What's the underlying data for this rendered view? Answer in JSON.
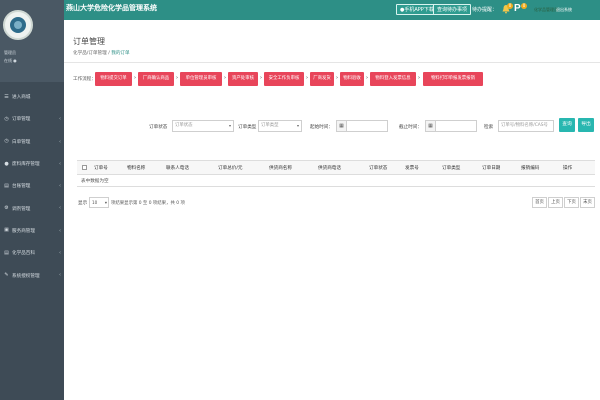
{
  "header": {
    "title": "燕山大学危险化学品管理系统",
    "btn_app_download": "●手机APP下载",
    "btn_query": "查询待办事项",
    "todo_label": "待办提醒：",
    "bell_badge": "0",
    "p_badge": "0",
    "user_label": "化学品管理员",
    "exit_label": "退出系统"
  },
  "sidebar": {
    "user_name": "管理员",
    "user_role": "在线 ●",
    "items": [
      {
        "label": "进入商城",
        "icon": "☰"
      },
      {
        "label": "订单管理",
        "icon": "◷"
      },
      {
        "label": "白单管理",
        "icon": "◷"
      },
      {
        "label": "废料库存管理",
        "icon": "●"
      },
      {
        "label": "台账管理",
        "icon": "▤"
      },
      {
        "label": "调剂管理",
        "icon": "⚙"
      },
      {
        "label": "服务商管理",
        "icon": "▣"
      },
      {
        "label": "化学品百科",
        "icon": "▤"
      },
      {
        "label": "系统授权管理",
        "icon": "✎"
      }
    ]
  },
  "page": {
    "title": "订单管理",
    "breadcrumb_root": "化学品/订单管理",
    "breadcrumb_sep": "/",
    "breadcrumb_active": "我的订单"
  },
  "flow": {
    "label": "工作流程：",
    "steps": [
      "物料提交订单",
      "厂商确认商品",
      "单位管理员审核",
      "资产处审核",
      "安全工作负审核",
      "厂商发货",
      "物料验收",
      "物料登入发票信息",
      "物料打印单报发票报销"
    ]
  },
  "filters": {
    "status_label": "订单状态",
    "status_value": "订单状态",
    "type_label": "订单类型",
    "type_value": "订单类型",
    "start_label": "起始时间：",
    "end_label": "截止时间：",
    "search_label": "检索",
    "search_placeholder": "订单号/物料名称/CAS号",
    "search_button": "查询",
    "export_button": "导出"
  },
  "table": {
    "headers": [
      "订单号",
      "物料名称",
      "联系人电话",
      "订单总价/元",
      "供货商名称",
      "供货商电话",
      "订单状态",
      "发票号",
      "订单类型",
      "订单日期",
      "报销编码",
      "操作"
    ],
    "empty_text": "表中数据为空"
  },
  "pagination": {
    "show_label": "显示",
    "page_size": "10",
    "info": "项结果显示第 0 至 0 项结果，共 0 项",
    "first": "首页",
    "prev": "上页",
    "next": "下页",
    "last": "末页"
  },
  "colors": {
    "topbar": "#2d8f86",
    "sidebar": "#3e4b56",
    "flow_step": "#e8455a",
    "button": "#28b7b0"
  }
}
